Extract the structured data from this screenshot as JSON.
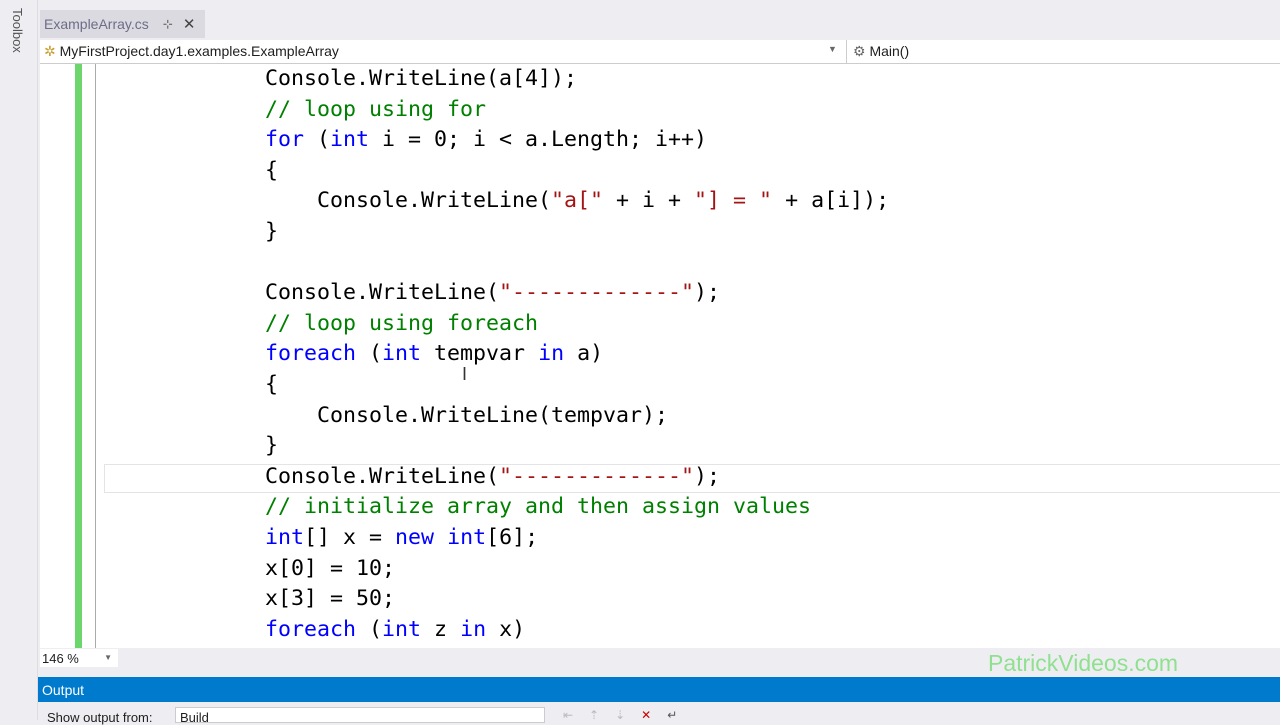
{
  "toolbox": {
    "label": "Toolbox"
  },
  "tab": {
    "label": "ExampleArray.cs",
    "pin": "⊹",
    "close": "✕"
  },
  "navbar": {
    "class_path": "MyFirstProject.day1.examples.ExampleArray",
    "member": "Main()"
  },
  "code": [
    [
      [
        "pl",
        "Console.WriteLine(a[4]);"
      ]
    ],
    [
      [
        "cm",
        "// loop using for"
      ]
    ],
    [
      [
        "kw",
        "for"
      ],
      [
        "pl",
        " ("
      ],
      [
        "kw",
        "int"
      ],
      [
        "pl",
        " i = 0; i < a.Length; i++)"
      ]
    ],
    [
      [
        "pl",
        "{"
      ]
    ],
    [
      [
        "pl",
        "    Console.WriteLine("
      ],
      [
        "str",
        "\"a[\""
      ],
      [
        "pl",
        " + i + "
      ],
      [
        "str",
        "\"] = \""
      ],
      [
        "pl",
        " + a[i]);"
      ]
    ],
    [
      [
        "pl",
        "}"
      ]
    ],
    [
      [
        "pl",
        ""
      ]
    ],
    [
      [
        "pl",
        "Console.WriteLine("
      ],
      [
        "str",
        "\"-------------\""
      ],
      [
        "pl",
        ");"
      ]
    ],
    [
      [
        "cm",
        "// loop using foreach"
      ]
    ],
    [
      [
        "kw",
        "foreach"
      ],
      [
        "pl",
        " ("
      ],
      [
        "kw",
        "int"
      ],
      [
        "pl",
        " tempvar "
      ],
      [
        "kw",
        "in"
      ],
      [
        "pl",
        " a)"
      ]
    ],
    [
      [
        "pl",
        "{"
      ]
    ],
    [
      [
        "pl",
        "    Console.WriteLine(tempvar);"
      ]
    ],
    [
      [
        "pl",
        "}"
      ]
    ],
    [
      [
        "pl",
        "Console.WriteLine("
      ],
      [
        "str",
        "\"-------------\""
      ],
      [
        "pl",
        ");"
      ]
    ],
    [
      [
        "cm",
        "// initialize array and then assign values"
      ]
    ],
    [
      [
        "kw",
        "int"
      ],
      [
        "pl",
        "[] x = "
      ],
      [
        "kw",
        "new"
      ],
      [
        "pl",
        " "
      ],
      [
        "kw",
        "int"
      ],
      [
        "pl",
        "[6];"
      ]
    ],
    [
      [
        "pl",
        "x[0] = 10;"
      ]
    ],
    [
      [
        "pl",
        "x[3] = 50;"
      ]
    ],
    [
      [
        "kw",
        "foreach"
      ],
      [
        "pl",
        " ("
      ],
      [
        "kw",
        "int"
      ],
      [
        "pl",
        " z "
      ],
      [
        "kw",
        "in"
      ],
      [
        "pl",
        " x)"
      ]
    ]
  ],
  "zoom": {
    "level": "146 %"
  },
  "watermark": "PatrickVideos.com",
  "output": {
    "title": "Output",
    "show_from_label": "Show output from:",
    "source": "Build"
  }
}
